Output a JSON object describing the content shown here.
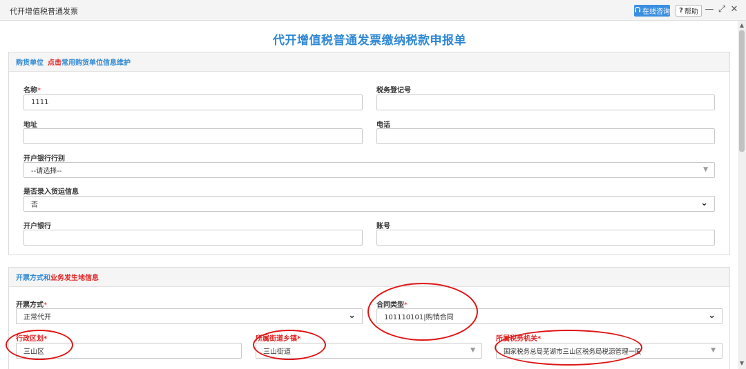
{
  "window": {
    "title": "代开增值税普通发票",
    "consult_label": "在线咨询",
    "help_label": "帮助",
    "minimize_glyph": "—",
    "restore_glyph": "⤢",
    "close_glyph": "✕"
  },
  "page_title": "代开增值税普通发票缴纳税款申报单",
  "buyer_section": {
    "title": "购货单位",
    "click_text": "点击",
    "link_text": "常用购货单位信息维护",
    "fields": {
      "name_label": "名称",
      "name_value": "1111",
      "tax_no_label": "税务登记号",
      "tax_no_value": "",
      "address_label": "地址",
      "address_value": "",
      "phone_label": "电话",
      "phone_value": "",
      "bank_branch_label": "开户银行行别",
      "bank_branch_value": "--请选择--",
      "freight_label": "是否录入货运信息",
      "freight_value": "否",
      "bank_label": "开户银行",
      "bank_value": "",
      "account_label": "账号",
      "account_value": ""
    }
  },
  "invoice_section": {
    "title_part1": "开票方式和",
    "title_part2": "业务发生地信息",
    "fields": {
      "method_label": "开票方式",
      "method_value": "正常代开",
      "contract_label": "合同类型",
      "contract_value": "101110101|购销合同",
      "district_label": "行政区划",
      "district_value": "三山区",
      "street_label": "所属街道乡镇",
      "street_value": "三山街道",
      "authority_label": "所属税务机关",
      "authority_value": "国家税务总局芜湖市三山区税务局税源管理一股"
    }
  },
  "required_mark": "*",
  "colors": {
    "accent_blue": "#2e88d4",
    "required_red": "#e12222",
    "annotation_red": "#e01515"
  }
}
